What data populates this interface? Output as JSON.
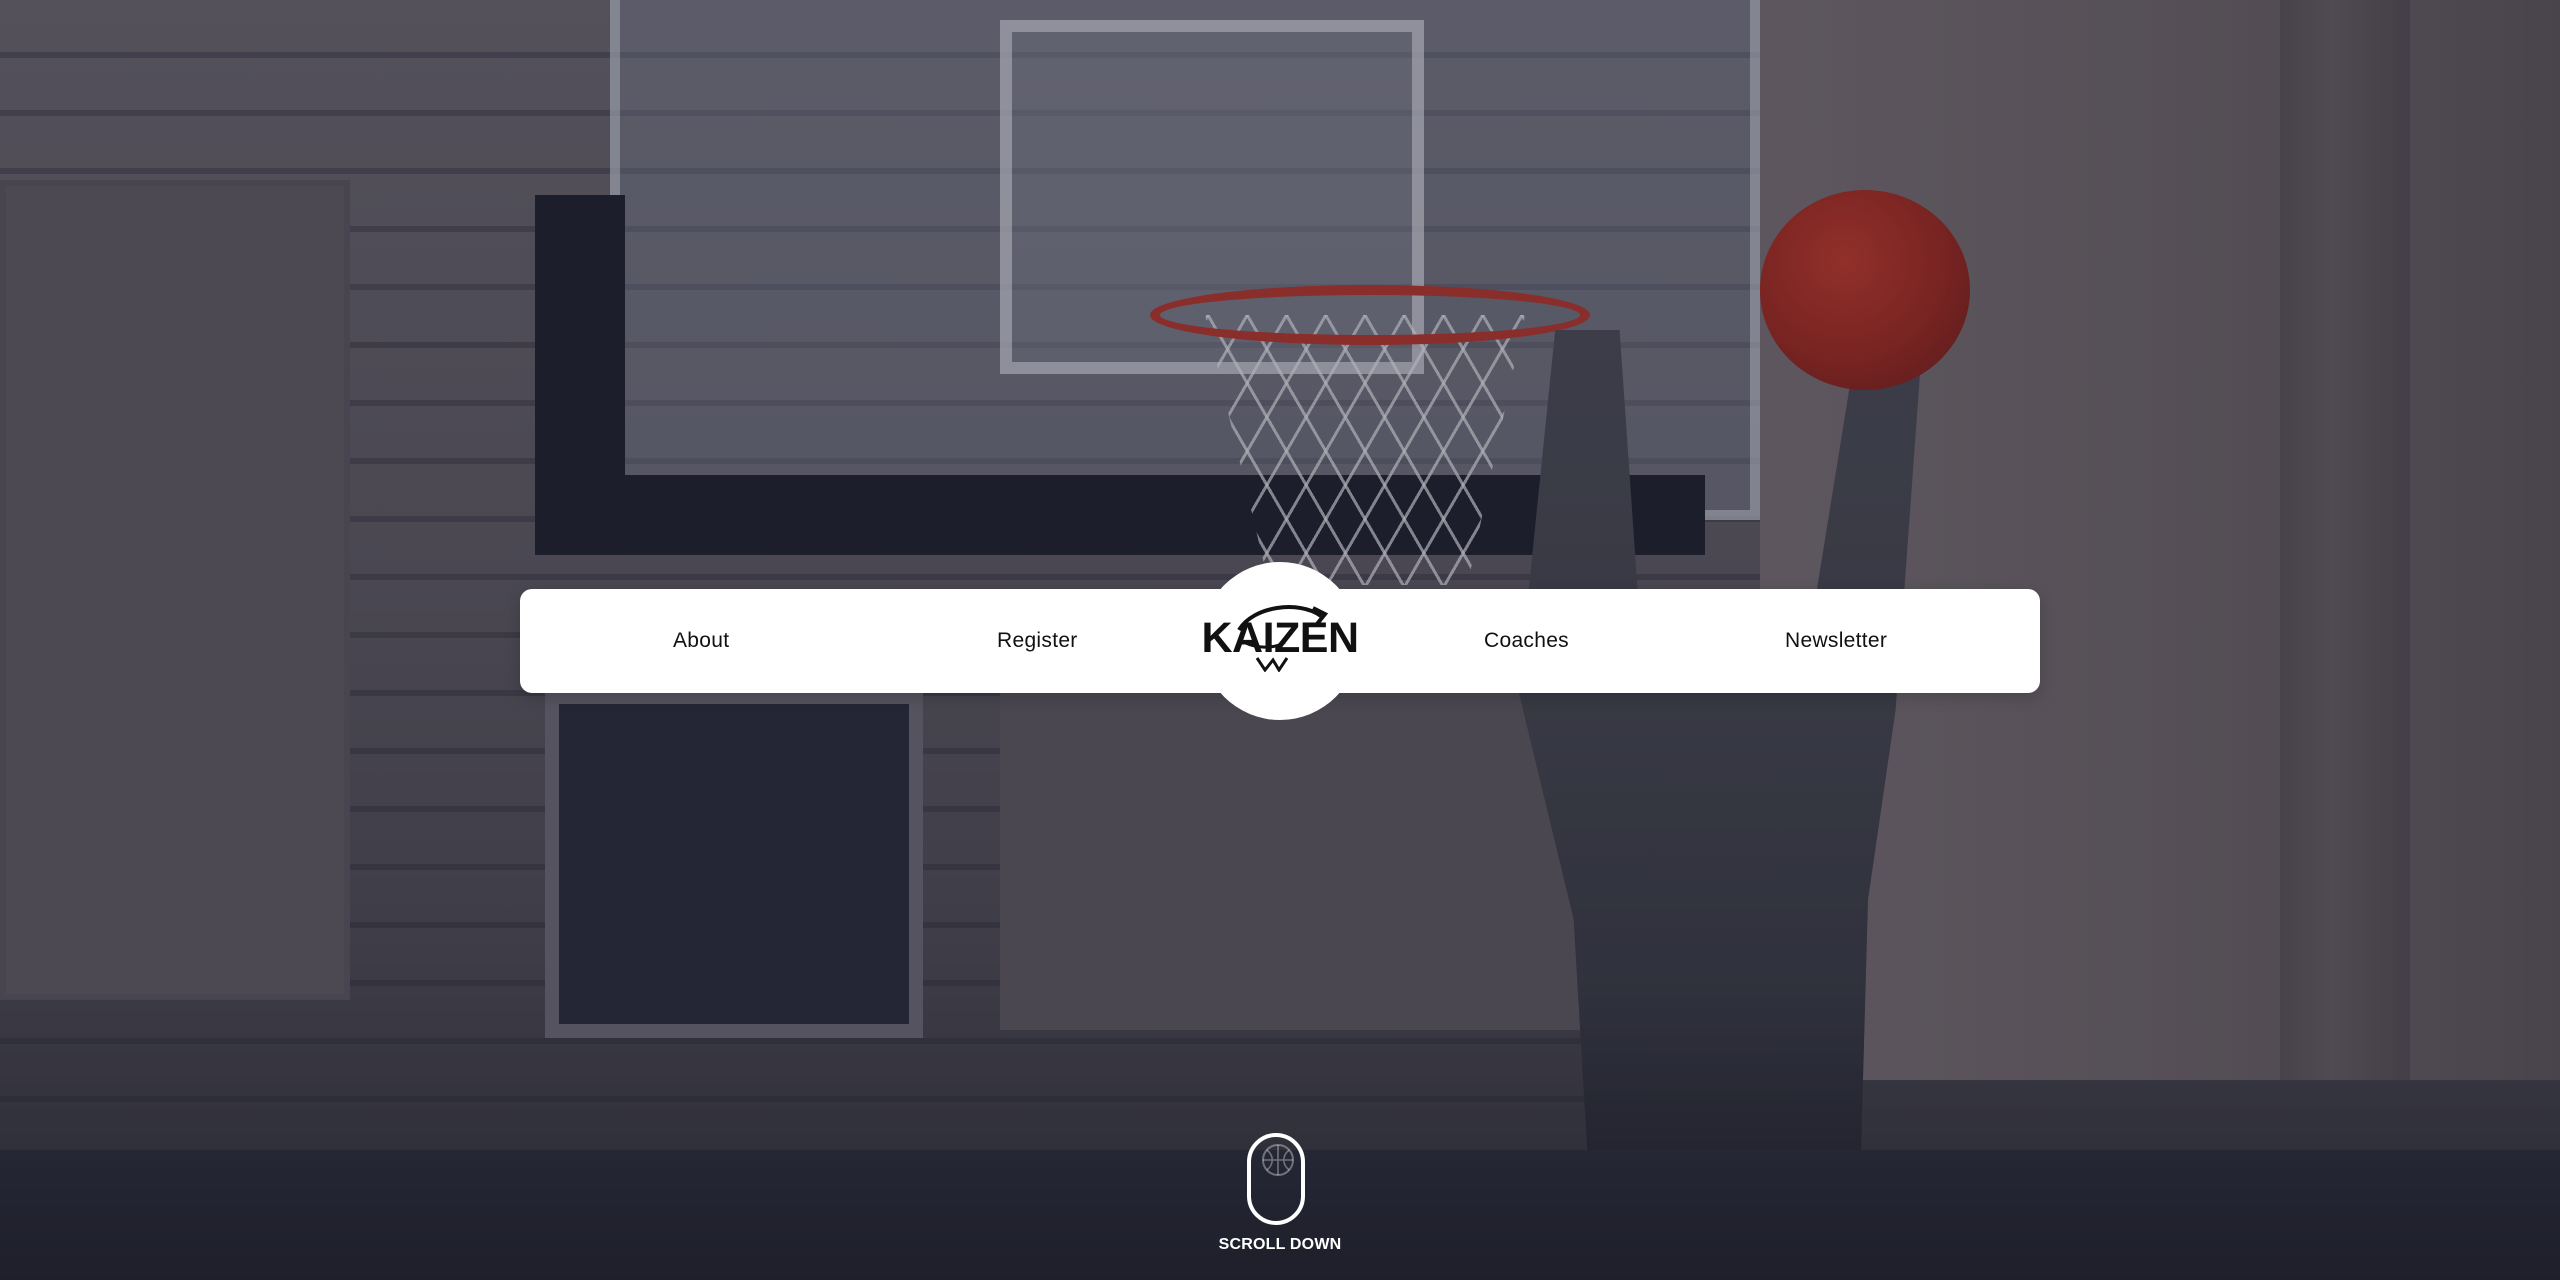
{
  "nav": {
    "items_left": [
      {
        "label": "About"
      },
      {
        "label": "Register"
      }
    ],
    "items_right": [
      {
        "label": "Coaches"
      },
      {
        "label": "Newsletter"
      }
    ]
  },
  "logo": {
    "text": "KAIZEN",
    "icon": "basketball-arrow-icon"
  },
  "scroll": {
    "label": "SCROLL DOWN",
    "icon": "mouse-scroll-icon"
  },
  "colors": {
    "nav_bg": "#ffffff",
    "nav_text": "#111111",
    "accent_white": "#ffffff"
  }
}
